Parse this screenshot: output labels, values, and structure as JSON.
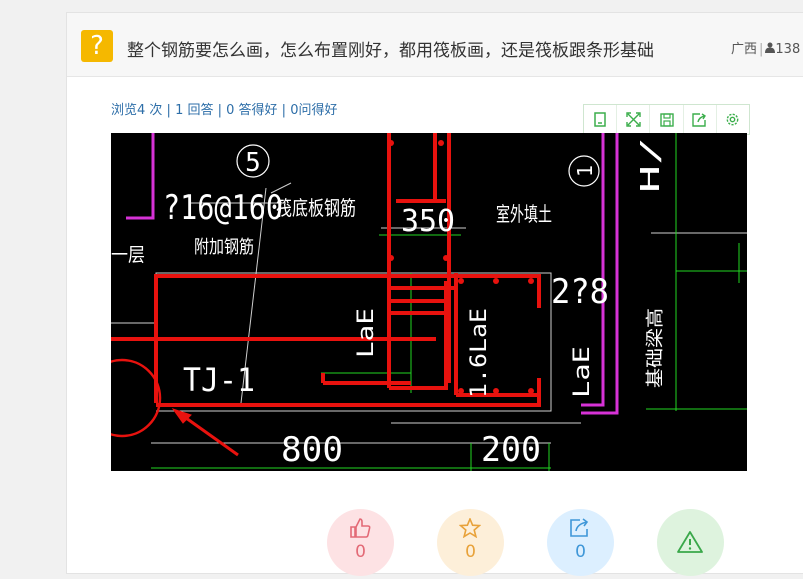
{
  "question": {
    "icon": "?",
    "title": "整个钢筋要怎么画，怎么布置刚好，都用筏板画，还是筏板跟条形基础",
    "region": "广西",
    "user_count": "138"
  },
  "stats": {
    "views": "浏览4 次",
    "answers": "1 回答",
    "good_answers": "0 答得好",
    "good_questions": "0问得好"
  },
  "toolbar": {
    "icons": [
      "page-icon",
      "fullscreen-icon",
      "save-icon",
      "share-icon",
      "settings-icon"
    ],
    "color": "#3cae4c"
  },
  "drawing": {
    "labels": {
      "axis": "5",
      "axis_right": "1",
      "rebar_spec": "?16@160",
      "bottom_rebar": "筏底板钢筋",
      "dim_350": "350",
      "outdoor_fill": "室外填土",
      "floor": "一层",
      "extra_rebar": "附加钢筋",
      "rebar_28": "2?8",
      "lae1": "LaE",
      "lae2": "1.6LaE",
      "lae3": "LaE",
      "beam_height": "基础梁高",
      "tj": "TJ-1",
      "dim_800": "800",
      "dim_200": "200",
      "h_label": "H/"
    },
    "colors": {
      "bg": "#000000",
      "red": "#e8120e",
      "white": "#ffffff",
      "magenta": "#d632d6",
      "green": "#22d622"
    }
  },
  "actions": [
    {
      "name": "like",
      "icon": "thumbs-up-icon",
      "count": "0",
      "bg": "#fde2e4",
      "color": "#e36a76"
    },
    {
      "name": "favorite",
      "icon": "star-icon",
      "count": "0",
      "bg": "#fdefd9",
      "color": "#e8a23a"
    },
    {
      "name": "share",
      "icon": "share-icon",
      "count": "0",
      "bg": "#dcefff",
      "color": "#3f97d8"
    },
    {
      "name": "report",
      "icon": "warning-icon",
      "count": "",
      "bg": "#def3de",
      "color": "#3aa84a"
    }
  ]
}
